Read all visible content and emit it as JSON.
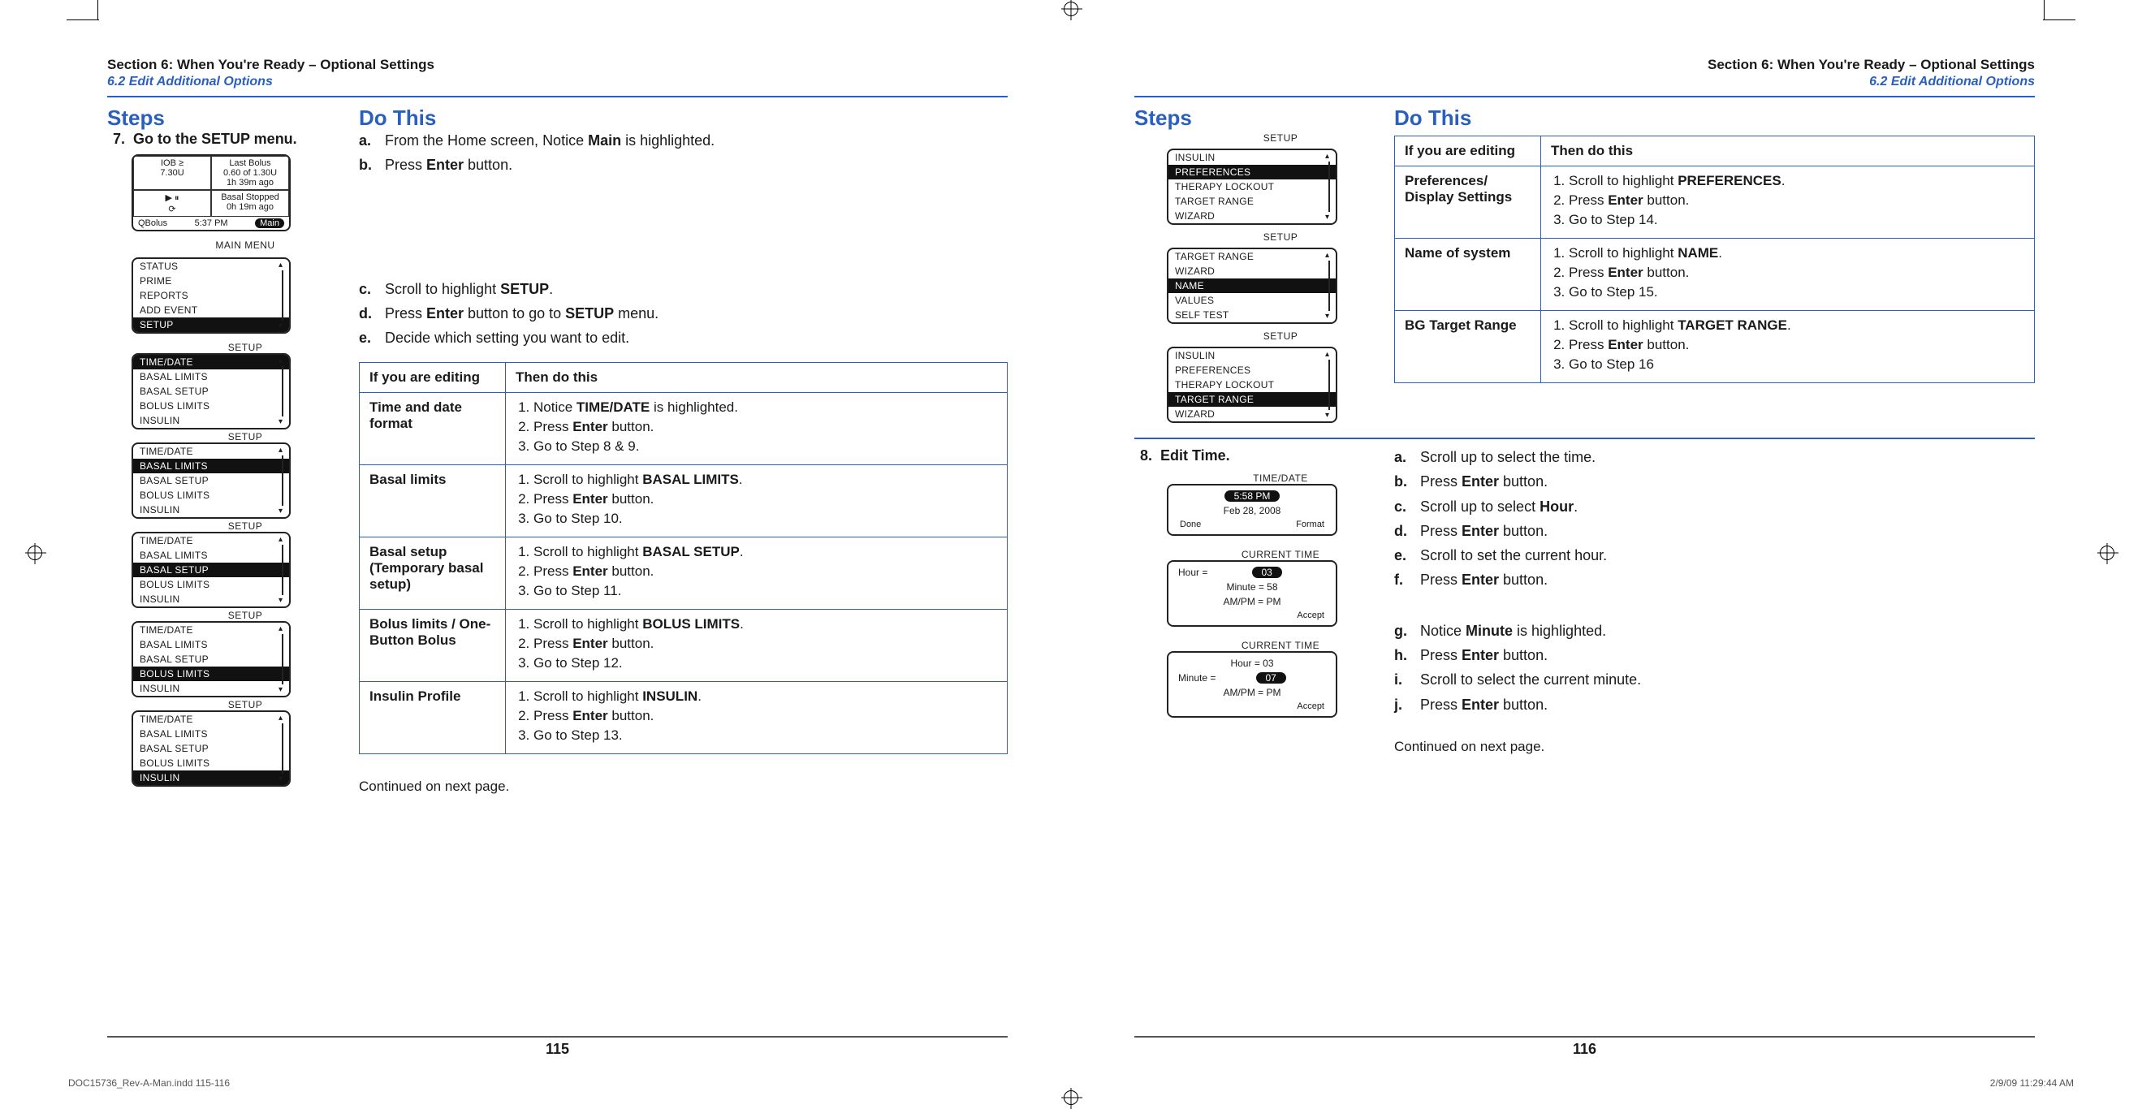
{
  "left": {
    "running_head": {
      "title": "Section 6: When You're Ready – Optional Settings",
      "sub": "6.2 Edit Additional Options"
    },
    "cols": {
      "steps": "Steps",
      "do": "Do This"
    },
    "step7": {
      "num": "7.",
      "title": "Go to the SETUP menu.",
      "home": {
        "iob_label": "IOB ≥",
        "iob_val": "7.30U",
        "last_bolus_title": "Last Bolus",
        "last_bolus_val": "0.60 of 1.30U",
        "last_bolus_time": "1h 39m ago",
        "stopped": "Basal Stopped",
        "stopped_time": "0h 19m ago",
        "l": "QBolus",
        "c": "5:37 PM",
        "r": "Main"
      },
      "mainmenu": {
        "title": "MAIN MENU",
        "items": [
          "STATUS",
          "PRIME",
          "REPORTS",
          "ADD EVENT",
          "SETUP"
        ],
        "hl": 4
      },
      "setup_items": [
        "TIME/DATE",
        "BASAL LIMITS",
        "BASAL SETUP",
        "BOLUS LIMITS",
        "INSULIN"
      ],
      "setup_title": "SETUP",
      "instr_ab": [
        {
          "l": "a.",
          "pre": "From the Home screen, Notice ",
          "bold": "Main",
          "post": " is highlighted."
        },
        {
          "l": "b.",
          "pre": "Press ",
          "bold": "Enter",
          "post": " button."
        }
      ],
      "instr_cde": [
        {
          "l": "c.",
          "pre": "Scroll to highlight ",
          "bold": "SETUP",
          "post": "."
        },
        {
          "l": "d.",
          "pre": "Press ",
          "bold": "Enter",
          "post_pre": " button to go to ",
          "bold2": "SETUP",
          "post": " menu."
        },
        {
          "l": "e.",
          "pre": "Decide which setting you want to edit.",
          "bold": "",
          "post": ""
        }
      ],
      "table": {
        "h1": "If you are editing",
        "h2": "Then do this",
        "rows": [
          {
            "name": "Time and date format",
            "steps": [
              [
                "Notice ",
                "TIME/DATE",
                " is highlighted."
              ],
              [
                "Press ",
                "Enter",
                " button."
              ],
              [
                "Go to Step 8 & 9.",
                "",
                ""
              ]
            ]
          },
          {
            "name": "Basal limits",
            "steps": [
              [
                "Scroll to highlight ",
                "BASAL LIMITS",
                "."
              ],
              [
                "Press ",
                "Enter",
                " button."
              ],
              [
                "Go to Step 10.",
                "",
                ""
              ]
            ]
          },
          {
            "name": "Basal setup (Temporary basal setup)",
            "steps": [
              [
                "Scroll to highlight ",
                "BASAL SETUP",
                "."
              ],
              [
                "Press ",
                "Enter",
                " button."
              ],
              [
                "Go to Step 11.",
                "",
                ""
              ]
            ]
          },
          {
            "name": "Bolus limits / One-Button Bolus",
            "steps": [
              [
                "Scroll to highlight ",
                "BOLUS LIMITS",
                "."
              ],
              [
                "Press ",
                "Enter",
                " button."
              ],
              [
                "Go to Step 12.",
                "",
                ""
              ]
            ]
          },
          {
            "name": "Insulin Profile",
            "steps": [
              [
                "Scroll to highlight ",
                "INSULIN",
                "."
              ],
              [
                "Press ",
                "Enter",
                " button."
              ],
              [
                "Go to Step 13.",
                "",
                ""
              ]
            ]
          }
        ]
      },
      "continued": "Continued on next page."
    },
    "page_num": "115"
  },
  "right": {
    "running_head": {
      "title": "Section 6: When You're Ready – Optional Settings",
      "sub": "6.2 Edit Additional Options"
    },
    "cols": {
      "steps": "Steps",
      "do": "Do This"
    },
    "setup_title": "SETUP",
    "setup_a": {
      "items": [
        "INSULIN",
        "PREFERENCES",
        "THERAPY LOCKOUT",
        "TARGET RANGE",
        "WIZARD"
      ],
      "hl": 1
    },
    "setup_b": {
      "items": [
        "TARGET RANGE",
        "WIZARD",
        "NAME",
        "VALUES",
        "SELF TEST"
      ],
      "hl": 2
    },
    "setup_c": {
      "items": [
        "INSULIN",
        "PREFERENCES",
        "THERAPY LOCKOUT",
        "TARGET RANGE",
        "WIZARD"
      ],
      "hl": 3
    },
    "table": {
      "h1": "If you are editing",
      "h2": "Then do this",
      "rows": [
        {
          "name": "Preferences/ Display Settings",
          "steps": [
            [
              "Scroll to highlight ",
              "PREFERENCES",
              "."
            ],
            [
              "Press ",
              "Enter",
              " button."
            ],
            [
              "Go to Step 14.",
              "",
              ""
            ]
          ]
        },
        {
          "name": "Name of system",
          "steps": [
            [
              "Scroll to highlight ",
              "NAME",
              "."
            ],
            [
              "Press ",
              "Enter",
              " button."
            ],
            [
              "Go to Step 15.",
              "",
              ""
            ]
          ]
        },
        {
          "name": "BG Target Range",
          "steps": [
            [
              "Scroll to highlight ",
              "TARGET RANGE",
              "."
            ],
            [
              "Press ",
              "Enter",
              " button."
            ],
            [
              "Go to Step 16",
              "",
              ""
            ]
          ]
        }
      ]
    },
    "step8": {
      "num": "8.",
      "title": "Edit Time.",
      "td_screen": {
        "title": "TIME/DATE",
        "time": "5:58 PM",
        "date": "Feb 28, 2008",
        "l": "Done",
        "r": "Format"
      },
      "ct1": {
        "title": "CURRENT TIME",
        "hour_lbl": "Hour =",
        "hour": "03",
        "minute": "Minute = 58",
        "ampm": "AM/PM = PM",
        "accept": "Accept"
      },
      "ct2": {
        "title": "CURRENT TIME",
        "hour": "Hour = 03",
        "minute_lbl": "Minute =",
        "minute": "07",
        "ampm": "AM/PM = PM",
        "accept": "Accept"
      },
      "instr_af": [
        {
          "l": "a.",
          "pre": "Scroll up to select the time.",
          "bold": "",
          "post": ""
        },
        {
          "l": "b.",
          "pre": "Press ",
          "bold": "Enter",
          "post": " button."
        },
        {
          "l": "c.",
          "pre": "Scroll up to select ",
          "bold": "Hour",
          "post": "."
        },
        {
          "l": "d.",
          "pre": "Press ",
          "bold": "Enter",
          "post": " button."
        },
        {
          "l": "e.",
          "pre": "Scroll to set the current hour.",
          "bold": "",
          "post": ""
        },
        {
          "l": "f.",
          "pre": "Press ",
          "bold": "Enter",
          "post": " button."
        }
      ],
      "instr_gj": [
        {
          "l": "g.",
          "pre": "Notice ",
          "bold": "Minute",
          "post": " is highlighted."
        },
        {
          "l": "h.",
          "pre": "Press ",
          "bold": "Enter",
          "post": " button."
        },
        {
          "l": "i.",
          "pre": "Scroll to select the current minute.",
          "bold": "",
          "post": ""
        },
        {
          "l": "j.",
          "pre": "Press ",
          "bold": "Enter",
          "post": " button."
        }
      ],
      "continued": "Continued on next page."
    },
    "page_num": "116"
  },
  "footer": {
    "file": "DOC15736_Rev-A-Man.indd   115-116",
    "stamp": "2/9/09   11:29:44 AM"
  }
}
